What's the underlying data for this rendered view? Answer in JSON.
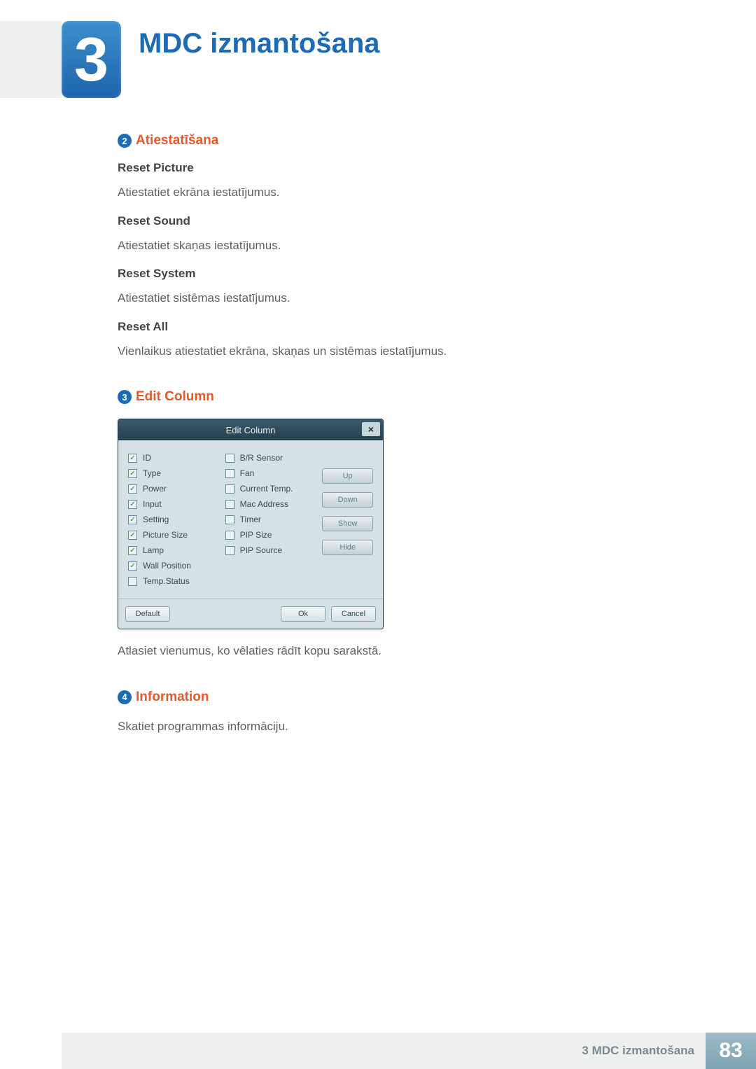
{
  "chapter": {
    "number": "3",
    "title": "MDC izmantošana"
  },
  "sections": {
    "s2": {
      "num": "2",
      "title": "Atiestatīšana",
      "items": [
        {
          "head": "Reset Picture",
          "text": "Atiestatiet ekrāna iestatījumus."
        },
        {
          "head": "Reset Sound",
          "text": "Atiestatiet skaņas iestatījumus."
        },
        {
          "head": "Reset System",
          "text": "Atiestatiet sistēmas iestatījumus."
        },
        {
          "head": "Reset All",
          "text": "Vienlaikus atiestatiet ekrāna, skaņas un sistēmas iestatījumus."
        }
      ]
    },
    "s3": {
      "num": "3",
      "title": "Edit Column",
      "caption": "Atlasiet vienumus, ko vēlaties rādīt kopu sarakstā."
    },
    "s4": {
      "num": "4",
      "title": "Information",
      "text": "Skatiet programmas informāciju."
    }
  },
  "dialog": {
    "title": "Edit Column",
    "col1": [
      {
        "label": "ID",
        "checked": true
      },
      {
        "label": "Type",
        "checked": true
      },
      {
        "label": "Power",
        "checked": true
      },
      {
        "label": "Input",
        "checked": true
      },
      {
        "label": "Setting",
        "checked": true
      },
      {
        "label": "Picture Size",
        "checked": true
      },
      {
        "label": "Lamp",
        "checked": true
      },
      {
        "label": "Wall Position",
        "checked": true
      },
      {
        "label": "Temp.Status",
        "checked": false
      }
    ],
    "col2": [
      {
        "label": "B/R Sensor",
        "checked": false
      },
      {
        "label": "Fan",
        "checked": false
      },
      {
        "label": "Current Temp.",
        "checked": false
      },
      {
        "label": "Mac Address",
        "checked": false
      },
      {
        "label": "Timer",
        "checked": false
      },
      {
        "label": "PIP Size",
        "checked": false
      },
      {
        "label": "PIP Source",
        "checked": false
      }
    ],
    "side": {
      "up": "Up",
      "down": "Down",
      "show": "Show",
      "hide": "Hide"
    },
    "footer": {
      "default": "Default",
      "ok": "Ok",
      "cancel": "Cancel"
    }
  },
  "footer": {
    "text": "3 MDC izmantošana",
    "page": "83"
  }
}
